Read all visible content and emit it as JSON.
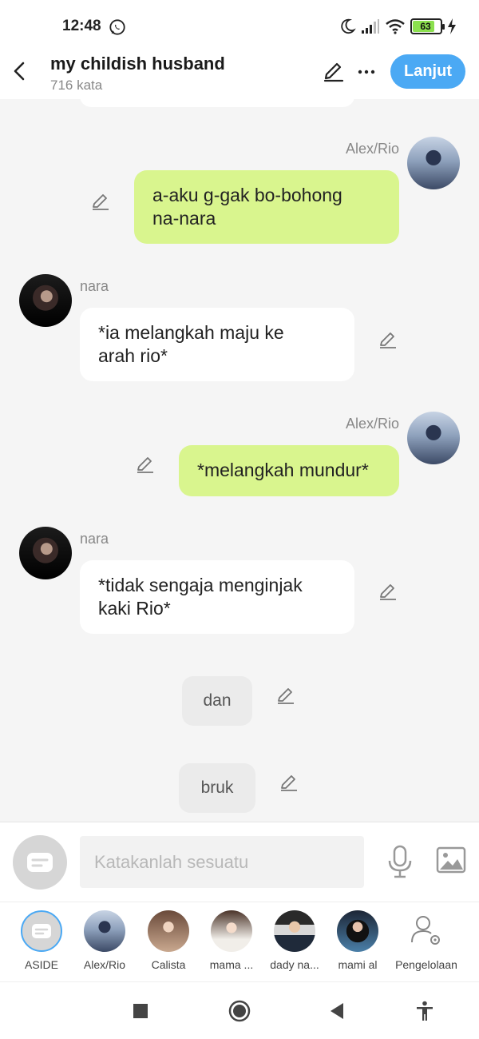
{
  "status_bar": {
    "time": "12:48",
    "battery": "63"
  },
  "header": {
    "title": "my childish husband",
    "subtitle": "716 kata",
    "next_label": "Lanjut"
  },
  "messages": [
    {
      "sender": "Alex/Rio",
      "text": "a-aku g-gak bo-bohong\nna-nara"
    },
    {
      "sender": "nara",
      "text": "*ia melangkah maju ke\narah rio*"
    },
    {
      "sender": "Alex/Rio",
      "text": "*melangkah mundur*"
    },
    {
      "sender": "nara",
      "text": "*tidak sengaja menginjak\nkaki Rio*"
    }
  ],
  "narration": [
    "dan",
    "bruk"
  ],
  "input": {
    "placeholder": "Katakanlah sesuatu"
  },
  "characters": [
    {
      "label": "ASIDE"
    },
    {
      "label": "Alex/Rio"
    },
    {
      "label": "Calista"
    },
    {
      "label": "mama ..."
    },
    {
      "label": "dady na..."
    },
    {
      "label": "mami al"
    },
    {
      "label": "Pengelolaan"
    }
  ],
  "colors": {
    "accent": "#4ba9f4",
    "my_bubble": "#d9f58e",
    "other_bubble": "#ffffff"
  }
}
